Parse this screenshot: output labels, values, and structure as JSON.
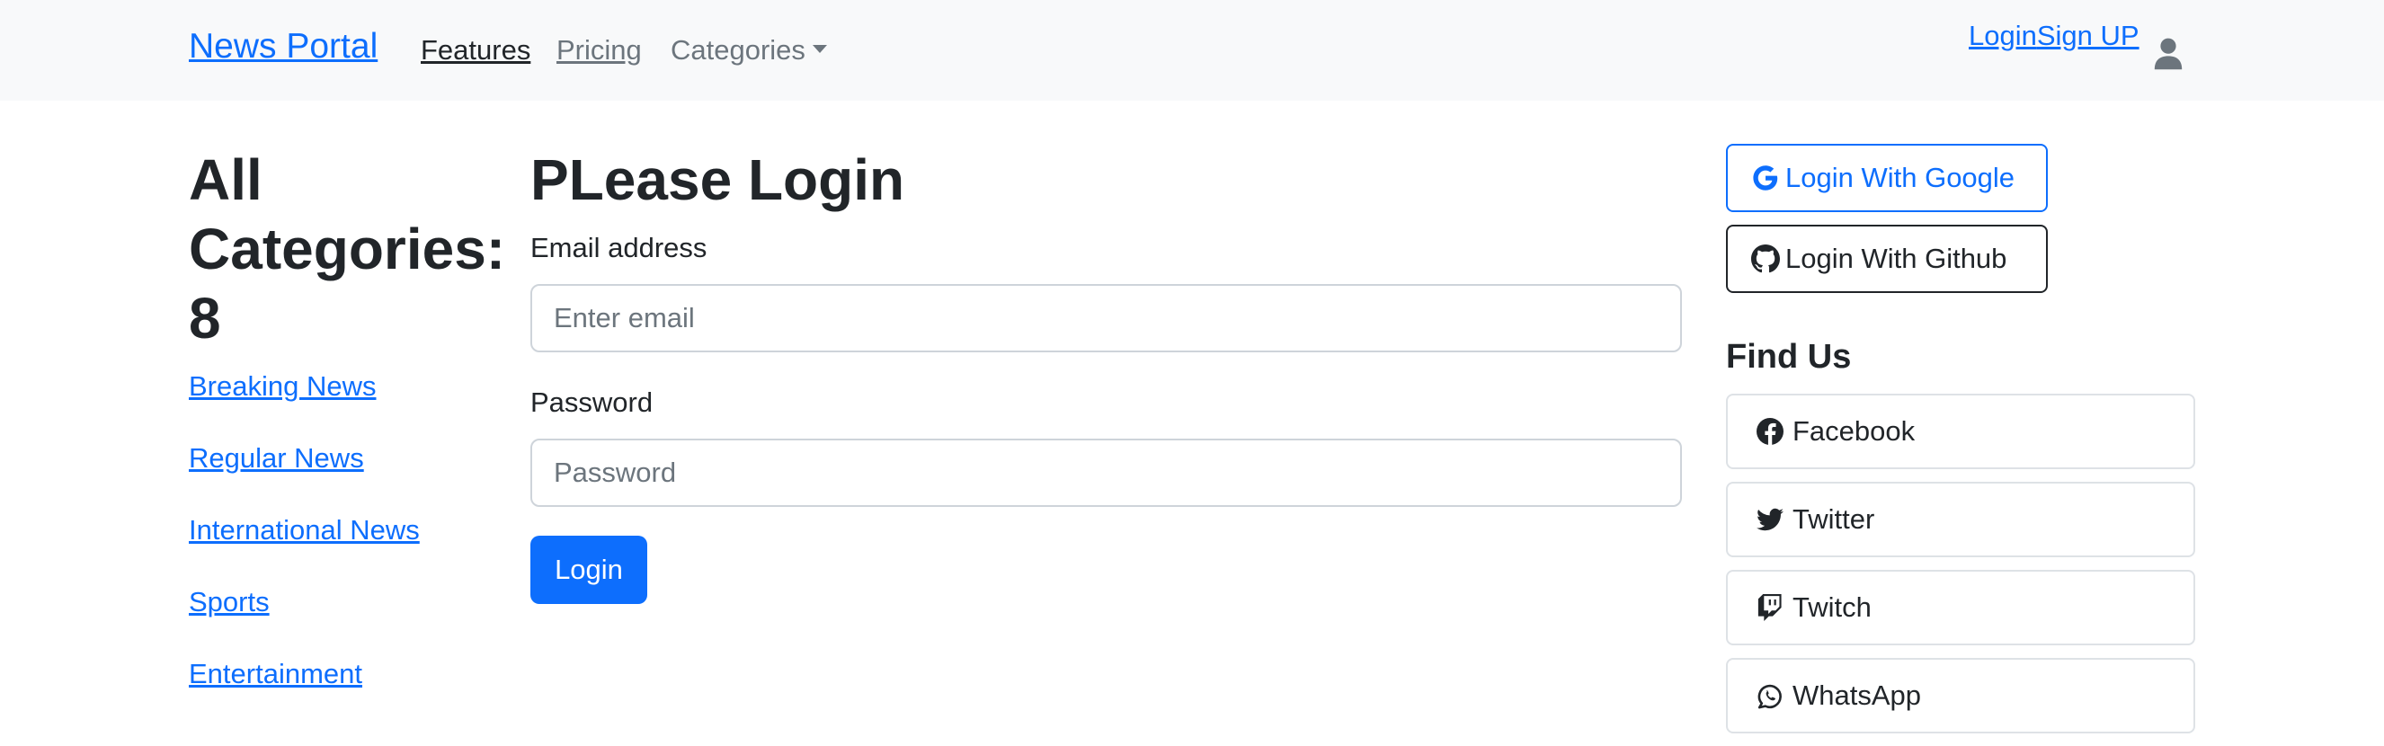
{
  "navbar": {
    "brand": "News Portal",
    "links": [
      "Features",
      "Pricing",
      "Categories"
    ],
    "login": "Login",
    "signup": "Sign UP",
    "user_icon": "user-icon"
  },
  "categories": {
    "title": "All Categories: 8",
    "items": [
      "Breaking News",
      "Regular News",
      "International News",
      "Sports",
      "Entertainment"
    ]
  },
  "login_form": {
    "title": "PLease Login",
    "email_label": "Email address",
    "email_placeholder": "Enter email",
    "password_label": "Password",
    "password_placeholder": "Password",
    "submit_label": "Login"
  },
  "social_login": {
    "google": "Login With Google",
    "github": "Login With Github"
  },
  "find_us": {
    "title": "Find Us",
    "items": [
      "Facebook",
      "Twitter",
      "Twitch",
      "WhatsApp"
    ]
  },
  "colors": {
    "primary": "#0d6efd",
    "navbar_bg": "#f8f9fa",
    "text": "#212529",
    "muted": "#6c757d"
  }
}
